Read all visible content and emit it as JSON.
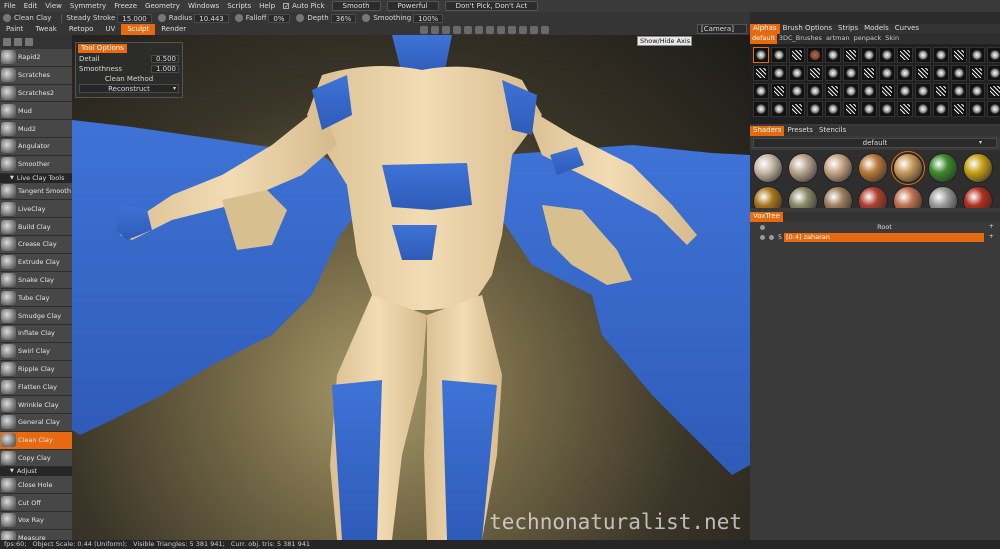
{
  "menubar": {
    "items": [
      "File",
      "Edit",
      "View",
      "Symmetry",
      "Freeze",
      "Geometry",
      "Windows",
      "Scripts",
      "Help"
    ],
    "auto_pick": "Auto Pick",
    "smooth": "Smooth",
    "powerful": "Powerful",
    "pick_mode": "Don't Pick, Don't Act"
  },
  "parambar": {
    "tool_name": "Clean Clay",
    "steady_label": "Steady Stroke",
    "steady_value": "15.000",
    "radius_label": "Radius",
    "radius_value": "10.443",
    "falloff_label": "Falloff",
    "falloff_value": "0%",
    "depth_label": "Depth",
    "depth_value": "36%",
    "smoothing_label": "Smoothing",
    "smoothing_value": "100%"
  },
  "rooms": [
    {
      "label": "Paint",
      "active": false
    },
    {
      "label": "Tweak",
      "active": false
    },
    {
      "label": "Retopo",
      "active": false
    },
    {
      "label": "UV",
      "active": false
    },
    {
      "label": "Sculpt",
      "active": true
    },
    {
      "label": "Render",
      "active": false
    }
  ],
  "camera": "[Camera]",
  "tooltip": "Show/Hide Axis",
  "tools": [
    {
      "label": "Rapid2",
      "section": null
    },
    {
      "label": "Scratches",
      "section": null
    },
    {
      "label": "Scratches2",
      "section": null
    },
    {
      "label": "Mud",
      "section": null
    },
    {
      "label": "Mud2",
      "section": null
    },
    {
      "label": "Angulator",
      "section": null
    },
    {
      "label": "Smoother",
      "section": null
    },
    {
      "label": "Tangent Smooth",
      "section": "Live Clay Tools"
    },
    {
      "label": "LiveClay",
      "section": null
    },
    {
      "label": "Build Clay",
      "section": null
    },
    {
      "label": "Crease Clay",
      "section": null
    },
    {
      "label": "Extrude Clay",
      "section": null
    },
    {
      "label": "Snake Clay",
      "section": null
    },
    {
      "label": "Tube Clay",
      "section": null
    },
    {
      "label": "Smudge Clay",
      "section": null
    },
    {
      "label": "Inflate Clay",
      "section": null
    },
    {
      "label": "Swirl Clay",
      "section": null
    },
    {
      "label": "Ripple Clay",
      "section": null
    },
    {
      "label": "Flatten Clay",
      "section": null
    },
    {
      "label": "Wrinkle Clay",
      "section": null
    },
    {
      "label": "General Clay",
      "section": null
    },
    {
      "label": "Clean Clay",
      "section": null,
      "active": true
    },
    {
      "label": "Copy Clay",
      "section": null
    },
    {
      "label": "Close Hole",
      "section": "Adjust"
    },
    {
      "label": "Cut Off",
      "section": null
    },
    {
      "label": "Vox Ray",
      "section": null
    },
    {
      "label": "Measure",
      "section": null
    }
  ],
  "tool_options": {
    "title": "Tool Options",
    "detail_label": "Detail",
    "detail_value": "0.500",
    "smoothness_label": "Smoothness",
    "smoothness_value": "1.000",
    "clean_method_label": "Clean Method",
    "clean_method_value": "Reconstruct"
  },
  "right_panel": {
    "tabs": [
      "Alphas",
      "Brush Options",
      "Strips",
      "Models",
      "Curves"
    ],
    "active_tab": "Alphas",
    "alpha_subtabs": [
      "default",
      "3DC_Brushes",
      "artman",
      "penpack",
      "Skin"
    ],
    "shader_tabs": [
      "Shaders",
      "Presets",
      "Stencils"
    ],
    "shader_preset": "default",
    "shaders": [
      {
        "color": "#c9b9a8"
      },
      {
        "color": "#b8a48f"
      },
      {
        "color": "#c7a585"
      },
      {
        "color": "#b87a3a"
      },
      {
        "color": "#c89b5a"
      },
      {
        "color": "#3f8a2e"
      },
      {
        "color": "#c8a018"
      },
      {
        "color": "#a8761e"
      },
      {
        "color": "#8a8a6a"
      },
      {
        "color": "#a08060"
      },
      {
        "color": "#b04030"
      },
      {
        "color": "#c07050"
      },
      {
        "color": "#9a9a9a"
      },
      {
        "color": "#b03020"
      }
    ],
    "voxtree_title": "VoxTree",
    "voxtree_root": "Root",
    "voxtree_item": "[0.4] zaharan",
    "voxtree_item_number": "5"
  },
  "status": {
    "fps": "fps:60;",
    "scale": "Object Scale: 0.44 (Uniform);",
    "visible": "Visible Triangles: 5 381 941;",
    "current": "Curr. obj. tris: 5 381 941"
  },
  "watermark": "technonaturalist.net",
  "colors": {
    "accent": "#e86a10",
    "skin": "#eed8b0",
    "clay_blue": "#3d6fd1"
  }
}
